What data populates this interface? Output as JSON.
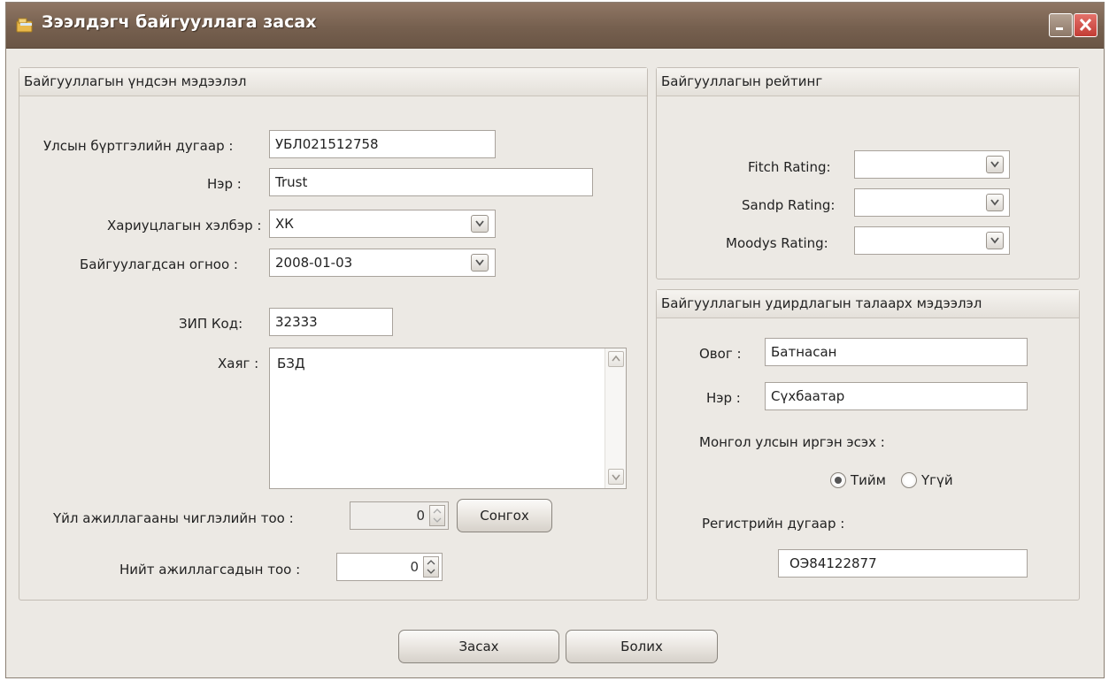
{
  "window": {
    "title": "Зээлдэгч байгууллага засах"
  },
  "main_info": {
    "header": "Байгууллагын үндсэн мэдээлэл",
    "reg_no_label": "Улсын бүртгэлийн дугаар :",
    "reg_no_value": "УБЛ021512758",
    "name_label": "Нэр :",
    "name_value": "Trust",
    "liability_label": "Хариуцлагын хэлбэр :",
    "liability_value": "ХК",
    "founded_label": "Байгуулагдсан огноо :",
    "founded_value": "2008-01-03",
    "zip_label": "ЗИП Код:",
    "zip_value": "32333",
    "address_label": "Хаяг :",
    "address_value": "БЗД",
    "activity_count_label": "Үйл ажиллагааны чиглэлийн тоо :",
    "activity_count_value": "0",
    "choose_button": "Сонгох",
    "employee_count_label": "Нийт ажиллагсадын тоо :",
    "employee_count_value": "0"
  },
  "rating": {
    "header": "Байгууллагын рейтинг",
    "fitch_label": "Fitch Rating:",
    "fitch_value": "",
    "sandp_label": "Sandp Rating:",
    "sandp_value": "",
    "moodys_label": "Moodys Rating:",
    "moodys_value": ""
  },
  "management": {
    "header": "Байгууллагын удирдлагын талаарх мэдээлэл",
    "surname_label": "Овог :",
    "surname_value": "Батнасан",
    "name_label": "Нэр :",
    "name_value": "Сүхбаатар",
    "citizen_label": "Монгол улсын иргэн эсэх :",
    "yes_label": "Тийм",
    "no_label": "Үгүй",
    "citizen_selected": "Тийм",
    "register_label": "Регистрийн дугаар :",
    "register_value": "ОЭ84122877"
  },
  "footer": {
    "edit_button": "Засах",
    "cancel_button": "Болих"
  },
  "colors": {
    "titlebar": "#76604f",
    "window_bg": "#ece9e4",
    "close_button": "#c23c35"
  }
}
